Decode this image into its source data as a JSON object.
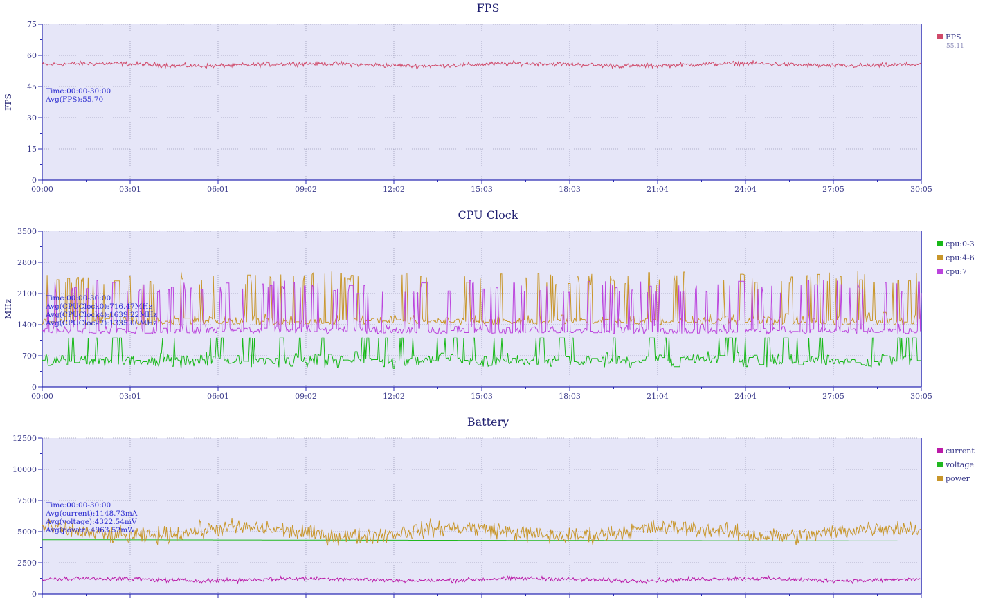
{
  "colors": {
    "plot_bg": "#e6e6f8",
    "axis": "#2b2bb3",
    "grid": "#9a9ab8",
    "tick_text": "#3a3a8a",
    "title_text": "#1f1f70",
    "annot_text": "#2a2ad0",
    "fps": "#d04a6a",
    "cpu03": "#18b818",
    "cpu46": "#c8962a",
    "cpu7": "#bb44dd",
    "current": "#bb1aa8",
    "voltage": "#20b820",
    "power": "#c8962a"
  },
  "chart_data": [
    {
      "id": "fps",
      "type": "line",
      "title": "FPS",
      "ylabel": "FPS",
      "xlabel": "",
      "ylim": [
        0,
        75
      ],
      "yticks": [
        "0",
        "15",
        "30",
        "45",
        "60",
        "75"
      ],
      "xticks": [
        "00:00",
        "03:01",
        "06:01",
        "09:02",
        "12:02",
        "15:03",
        "18:03",
        "21:04",
        "24:04",
        "27:05",
        "30:05"
      ],
      "grid": true,
      "legend_position": "right",
      "annotations": [
        "Time:00:00-30:00",
        "Avg(FPS):55.70"
      ],
      "series": [
        {
          "name": "FPS",
          "legend_value": "55.11",
          "color_key": "fps",
          "mean": 55.5,
          "noise": 1.6,
          "min": 50,
          "max": 60
        }
      ]
    },
    {
      "id": "cpu",
      "type": "line",
      "title": "CPU Clock",
      "ylabel": "MHz",
      "xlabel": "",
      "ylim": [
        0,
        3500
      ],
      "yticks": [
        "0",
        "700",
        "1400",
        "2100",
        "2800",
        "3500"
      ],
      "xticks": [
        "00:00",
        "03:01",
        "06:01",
        "09:02",
        "12:02",
        "15:03",
        "18:03",
        "21:04",
        "24:04",
        "27:05",
        "30:05"
      ],
      "grid": true,
      "legend_position": "right",
      "annotations": [
        "Time:00:00-30:00",
        "Avg(CPUClock0):716.47MHz",
        "Avg(CPUClock4):1639.22MHz",
        "Avg(CPUClock7):1335.00MHz"
      ],
      "series": [
        {
          "name": "cpu:0-3",
          "color_key": "cpu03",
          "mean": 716.47,
          "base": 600,
          "noise": 220,
          "min": 250,
          "max": 1100
        },
        {
          "name": "cpu:4-6",
          "color_key": "cpu46",
          "mean": 1639.22,
          "base": 1400,
          "noise": 500,
          "min": 1100,
          "max": 2600
        },
        {
          "name": "cpu:7",
          "color_key": "cpu7",
          "mean": 1335.0,
          "base": 1200,
          "noise": 400,
          "min": 1200,
          "max": 2400
        }
      ]
    },
    {
      "id": "battery",
      "type": "line",
      "title": "Battery",
      "ylabel": "",
      "xlabel": "",
      "ylim": [
        0,
        12500
      ],
      "yticks": [
        "0",
        "2500",
        "5000",
        "7500",
        "10000",
        "12500"
      ],
      "xticks": [],
      "grid": true,
      "legend_position": "right",
      "annotations": [
        "Time:00:00-30:00",
        "Avg(current):1148.73mA",
        "Avg(voltage):4322.54mV",
        "Avg(power):4963.52mW"
      ],
      "series": [
        {
          "name": "current",
          "color_key": "current",
          "mean": 1148.73,
          "noise": 250,
          "min": 700,
          "max": 2100
        },
        {
          "name": "voltage",
          "color_key": "voltage",
          "mean": 4322.54,
          "start": 4350,
          "end": 4250
        },
        {
          "name": "power",
          "color_key": "power",
          "mean": 4963.52,
          "noise": 1000,
          "min": 2000,
          "max": 9000
        }
      ]
    }
  ]
}
